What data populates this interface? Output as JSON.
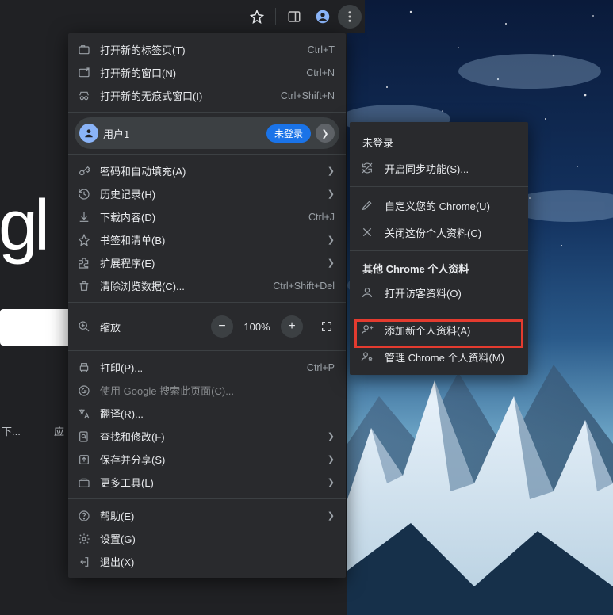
{
  "background": {
    "google_fragment": "gl",
    "text_under1": "下...",
    "text_under2": "应"
  },
  "topbar": {
    "star": "star-icon",
    "panel": "side-panel-icon",
    "avatar": "profile-icon",
    "more": "more-vert-icon"
  },
  "menu": {
    "new_tab": {
      "label": "打开新的标签页(T)",
      "shortcut": "Ctrl+T"
    },
    "new_window": {
      "label": "打开新的窗口(N)",
      "shortcut": "Ctrl+N"
    },
    "incognito": {
      "label": "打开新的无痕式窗口(I)",
      "shortcut": "Ctrl+Shift+N"
    },
    "user": {
      "label": "用户1",
      "badge": "未登录"
    },
    "passwords": {
      "label": "密码和自动填充(A)"
    },
    "history": {
      "label": "历史记录(H)"
    },
    "downloads": {
      "label": "下载内容(D)",
      "shortcut": "Ctrl+J"
    },
    "bookmarks": {
      "label": "书签和清单(B)"
    },
    "extensions": {
      "label": "扩展程序(E)"
    },
    "clear_data": {
      "label": "清除浏览数据(C)...",
      "shortcut": "Ctrl+Shift+Del"
    },
    "zoom": {
      "label": "缩放",
      "value": "100%"
    },
    "print": {
      "label": "打印(P)...",
      "shortcut": "Ctrl+P"
    },
    "google_search": {
      "label": "使用 Google 搜索此页面(C)..."
    },
    "translate": {
      "label": "翻译(R)..."
    },
    "find": {
      "label": "查找和修改(F)"
    },
    "save_share": {
      "label": "保存并分享(S)"
    },
    "more_tools": {
      "label": "更多工具(L)"
    },
    "help": {
      "label": "帮助(E)"
    },
    "settings": {
      "label": "设置(G)"
    },
    "exit": {
      "label": "退出(X)"
    }
  },
  "submenu": {
    "title": "未登录",
    "sync": {
      "label": "开启同步功能(S)..."
    },
    "customize": {
      "label": "自定义您的 Chrome(U)"
    },
    "close_profile": {
      "label": "关闭这份个人资料(C)"
    },
    "section_other": "其他 Chrome 个人资料",
    "guest": {
      "label": "打开访客资料(O)"
    },
    "add_profile": {
      "label": "添加新个人资料(A)"
    },
    "manage": {
      "label": "管理 Chrome 个人资料(M)"
    }
  }
}
